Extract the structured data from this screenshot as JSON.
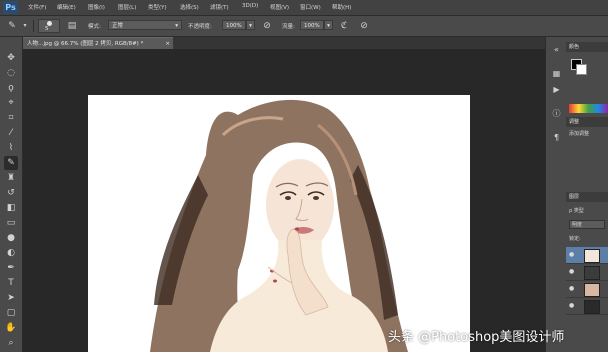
{
  "app": {
    "logo": "Ps"
  },
  "menu": [
    "文件(F)",
    "编辑(E)",
    "图像(I)",
    "图层(L)",
    "类型(Y)",
    "选择(S)",
    "滤镜(T)",
    "3D(D)",
    "视图(V)",
    "窗口(W)",
    "帮助(H)"
  ],
  "options": {
    "brush_size": "5",
    "mode_label": "模式:",
    "mode_value": "正常",
    "opacity_label": "不透明度:",
    "opacity_value": "100%",
    "flow_label": "流量:",
    "flow_value": "100%"
  },
  "document": {
    "tab_title": "人物…jpg @ 66.7% (图层 2 拷贝, RGB/8#) *",
    "close": "×"
  },
  "panels": {
    "color_tab": "颜色",
    "adjust_tab": "调整",
    "style_tab": "样式",
    "add_adjust": "添加调整",
    "layers_tab": "图层",
    "channels_tab": "通道",
    "kind_label": "ρ 类型",
    "blend_mode": "明度",
    "lock_label": "锁定:"
  },
  "watermark": "头条 @Photoshop美图设计师",
  "colors": {
    "accent": "#2a4c72",
    "canvas": "#ffffff",
    "workspace": "#282828"
  }
}
